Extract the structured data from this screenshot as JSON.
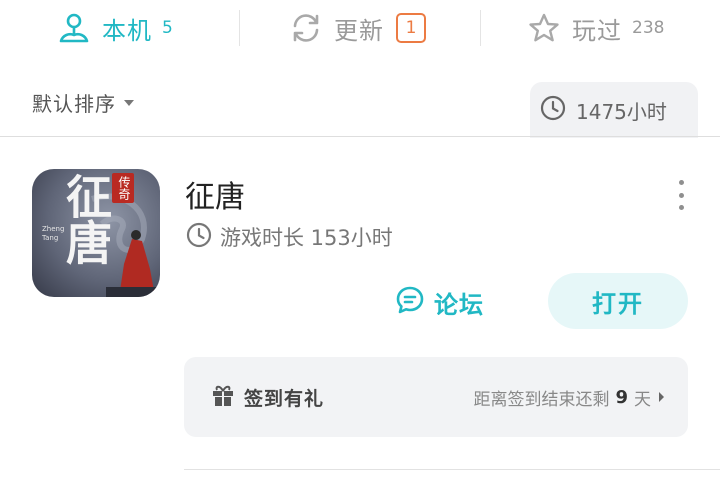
{
  "tabs": {
    "local": {
      "label": "本机",
      "count": "5",
      "icon": "user-device-icon"
    },
    "update": {
      "label": "更新",
      "count": "1",
      "icon": "refresh-icon"
    },
    "played": {
      "label": "玩过",
      "count": "238",
      "icon": "star-icon"
    }
  },
  "sort": {
    "label": "默认排序",
    "icon": "caret-down-icon"
  },
  "total_time": {
    "value": "1475小时",
    "icon": "clock-icon"
  },
  "game": {
    "title": "征唐",
    "icon_text": {
      "main": "征唐",
      "badge": "传奇",
      "sub": "Zheng Tang"
    },
    "playtime_label": "游戏时长 153小时",
    "forum_label": "论坛",
    "open_label": "打开"
  },
  "checkin": {
    "label": "签到有礼",
    "prefix": "距离签到结束还剩",
    "days": "9",
    "suffix": "天"
  },
  "colors": {
    "accent": "#21b8c4",
    "badge": "#ec7b43"
  }
}
